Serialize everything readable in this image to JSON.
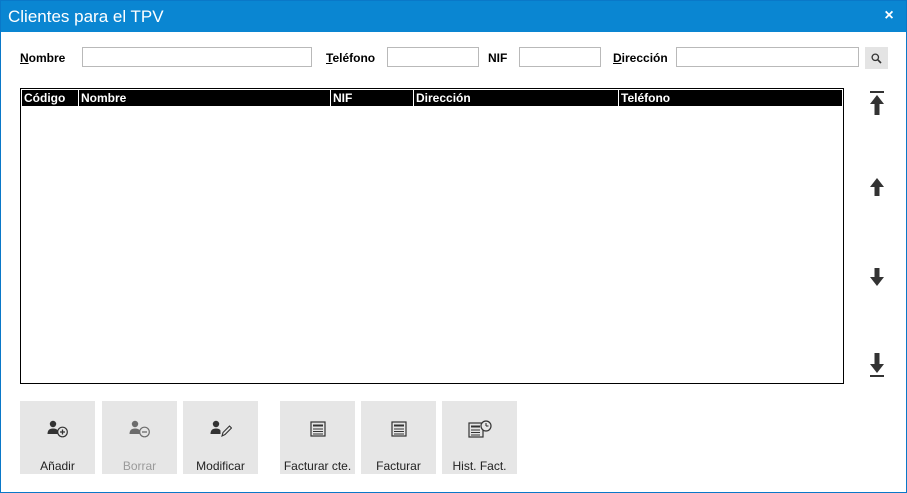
{
  "window": {
    "title": "Clientes para el TPV",
    "close_glyph": "×"
  },
  "filters": {
    "nombre_label_u": "N",
    "nombre_label_rest": "ombre",
    "nombre_value": "",
    "telefono_label_u": "T",
    "telefono_label_rest": "eléfono",
    "telefono_value": "",
    "nif_label": "NIF",
    "nif_value": "",
    "direccion_label_u": "D",
    "direccion_label_rest": "irección",
    "direccion_value": "",
    "search_icon": "search-icon"
  },
  "grid": {
    "columns": [
      "Código",
      "Nombre",
      "NIF",
      "Dirección",
      "Teléfono"
    ],
    "rows": []
  },
  "nav": {
    "first": "arrow-to-top-icon",
    "up": "arrow-up-icon",
    "down": "arrow-down-icon",
    "last": "arrow-to-bottom-icon"
  },
  "actions": {
    "add": "Añadir",
    "delete": "Borrar",
    "modify": "Modificar",
    "invoice_customer": "Facturar cte.",
    "invoice": "Facturar",
    "invoice_history": "Hist. Fact."
  },
  "colors": {
    "titlebar": "#0a86d2",
    "button_bg": "#e6e6e6",
    "grid_header": "#000000",
    "disabled_text": "#9a9a9a"
  }
}
